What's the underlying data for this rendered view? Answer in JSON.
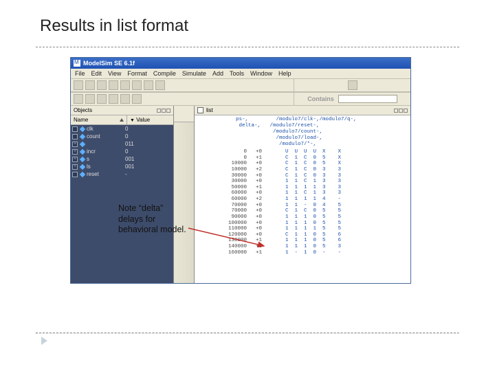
{
  "slide": {
    "title": "Results in list format"
  },
  "app": {
    "title": "ModelSim SE 6.1f",
    "menus": [
      "File",
      "Edit",
      "View",
      "Format",
      "Compile",
      "Simulate",
      "Add",
      "Tools",
      "Window",
      "Help"
    ],
    "contains_label": "Contains"
  },
  "objects_panel": {
    "label": "Objects",
    "columns": {
      "name": "Name",
      "value": "Value"
    },
    "signals": [
      {
        "name": "clk",
        "value": "0",
        "expand": null
      },
      {
        "name": "count",
        "value": "0",
        "expand": null
      },
      {
        "name": "",
        "value": "011",
        "expand": "+"
      },
      {
        "name": "incr",
        "value": "0",
        "expand": "+"
      },
      {
        "name": "s",
        "value": "001",
        "expand": "+"
      },
      {
        "name": "ls",
        "value": "001",
        "expand": "+"
      },
      {
        "name": "reset",
        "value": "-",
        "expand": null
      }
    ]
  },
  "list_panel": {
    "label": "list",
    "header_lines": [
      "ps-,         /modulo7/clk-,/modulo7/q-,",
      " delta-,   /modulo7/reset-,",
      "            /modulo7/count-,",
      "             /modulo7/load-,",
      "              /modulo7/*-,"
    ],
    "rows": [
      {
        "t": "0",
        "d": "+0",
        "v": "U  U  U  U  X    X"
      },
      {
        "t": "0",
        "d": "+1",
        "v": "C  1  C  0  5    X"
      },
      {
        "t": "10000",
        "d": "+0",
        "v": "C  1  C  0  5    X"
      },
      {
        "t": "10000",
        "d": "+2",
        "v": "C  1  C  0  3    3"
      },
      {
        "t": "30000",
        "d": "+0",
        "v": "C  1  C  0  3    3"
      },
      {
        "t": "30000",
        "d": "+0",
        "v": "1  1  C  1  3    3"
      },
      {
        "t": "50000",
        "d": "+1",
        "v": "1  1  1  1  3    3"
      },
      {
        "t": "60000",
        "d": "+0",
        "v": "1  1  C  1  3    3"
      },
      {
        "t": "60000",
        "d": "+2",
        "v": "1  1  1  1  4    -"
      },
      {
        "t": "70000",
        "d": "+0",
        "v": "1  1  -  0  4    5"
      },
      {
        "t": "70000",
        "d": "+0",
        "v": "C  1  C  0  5    5"
      },
      {
        "t": "90000",
        "d": "+0",
        "v": "1  1  1  0  5    5"
      },
      {
        "t": "100000",
        "d": "+0",
        "v": "1  1  1  0  5    5"
      },
      {
        "t": "110000",
        "d": "+0",
        "v": "1  1  1  1  5    5"
      },
      {
        "t": "120000",
        "d": "+0",
        "v": "C  1  1  0  5    6"
      },
      {
        "t": "130000",
        "d": "+1",
        "v": "1  1  1  0  5    6"
      },
      {
        "t": "140000",
        "d": "+3",
        "v": "1  1  1  0  5    3"
      },
      {
        "t": "160000",
        "d": "+1",
        "v": "1  -  1  0  -    -"
      }
    ]
  },
  "annotation": {
    "text": "Note “delta” delays for behavioral model."
  }
}
